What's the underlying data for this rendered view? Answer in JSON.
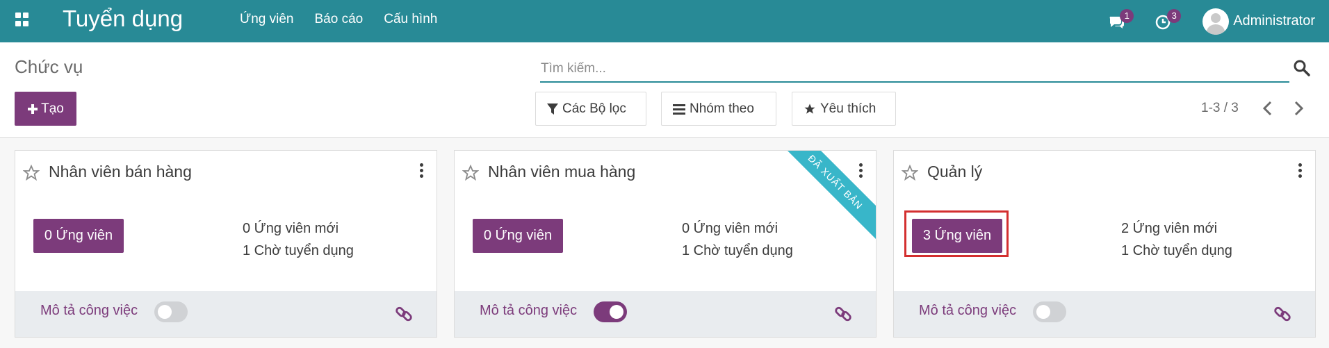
{
  "navbar": {
    "app_title": "Tuyển dụng",
    "menu": [
      "Ứng viên",
      "Báo cáo",
      "Cấu hình"
    ],
    "messages_count": "1",
    "activities_count": "3",
    "user_name": "Administrator"
  },
  "control_panel": {
    "breadcrumb": "Chức vụ",
    "create_label": "Tạo",
    "search_placeholder": "Tìm kiếm...",
    "filters_label": "Các Bộ lọc",
    "groupby_label": "Nhóm theo",
    "favorites_label": "Yêu thích",
    "pager": "1-3 / 3"
  },
  "cards": [
    {
      "title": "Nhân viên bán hàng",
      "applicants_button": "0 Ứng viên",
      "new_applicants": "0 Ứng viên mới",
      "to_recruit": "1 Chờ tuyển dụng",
      "job_description_label": "Mô tả công việc",
      "job_description_on": false,
      "ribbon": ""
    },
    {
      "title": "Nhân viên mua hàng",
      "applicants_button": "0 Ứng viên",
      "new_applicants": "0 Ứng viên mới",
      "to_recruit": "1 Chờ tuyển dụng",
      "job_description_label": "Mô tả công việc",
      "job_description_on": true,
      "ribbon": "ĐÃ XUẤT BẢN"
    },
    {
      "title": "Quản lý",
      "applicants_button": "3 Ứng viên",
      "new_applicants": "2 Ứng viên mới",
      "to_recruit": "1 Chờ tuyển dụng",
      "job_description_label": "Mô tả công việc",
      "job_description_on": false,
      "ribbon": ""
    }
  ],
  "colors": {
    "navbar": "#288a96",
    "primary": "#7c3b7b",
    "ribbon": "#38b6c9",
    "highlight": "#d32f2f"
  }
}
